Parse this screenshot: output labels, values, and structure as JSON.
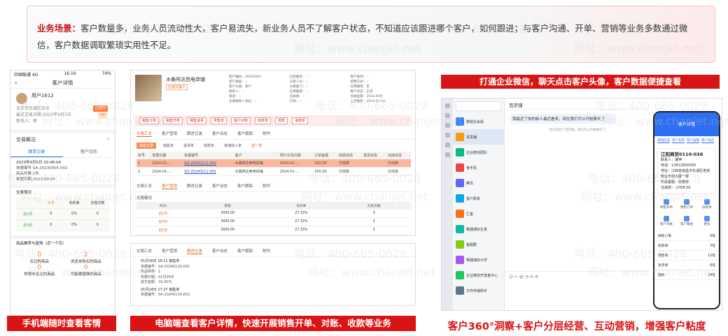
{
  "scenario": {
    "label": "业务场景：",
    "text": "客户数量多，业务人员流动性大，客户易流失，新业务人员不了解客户状态，不知道应该跟进哪个客户，如何跟进；与客户沟通、开单、营销等业务多数通过微信，客户数据调取繁琐实用性不足。"
  },
  "captions": {
    "phone": "手机端随时查看客情",
    "desktop": "电脑端查看客户详情，快速开展销售开单、对账、收款等业务",
    "wecom_title": "打通企业微信，聊天点击客户头像，客户数据便捷查看",
    "bottom_slogan": "客户360°洞察+客户分层经营、互动营销，增强客户粘度"
  },
  "watermarks": {
    "phone": "电话：400-665-0028",
    "site": "网址：www.chanjet.net"
  },
  "phone": {
    "status_left": "中国联通 4G",
    "status_time": "16:16",
    "status_right": "74%",
    "nav_title": "客户详情",
    "customer_name": "用户1612",
    "customer_sub": "北京市东城区东华",
    "customer_line2": "最近交易日期:2023年9月5日",
    "customer_line3": "联系人：郭",
    "tag": "已成交",
    "level": "VIP",
    "row_label": "交易概况",
    "tabs": [
      "跟单记录",
      "客户动态"
    ],
    "log_time": "2023年9月5日 10:46:04",
    "log_1": "单据编号:SA-20230905-002",
    "log_2": "商品件数:1件",
    "log_3": "单据日期:2023-09-05",
    "trade_title": "交易情况",
    "grid_head": [
      "",
      "本月",
      "毛利率",
      "交易次数"
    ],
    "grid_rows": [
      [
        "近1月",
        "0",
        "0%",
        "0"
      ],
      [
        "近3月",
        "0",
        "0%",
        "0"
      ]
    ],
    "goods_title": "商品推荐与复购（近一个月）",
    "big": [
      {
        "num": "0",
        "label": "买过的商品"
      },
      {
        "num": "2",
        "label": "浏览未购买的商品"
      },
      {
        "num": "0",
        "label": "热销未关注的商品"
      },
      {
        "num": "0",
        "label": "可能被替换的商品"
      }
    ]
  },
  "desktop": {
    "title": "木桑阿达西电焊铺",
    "sub": "已成交客户",
    "cols": [
      [
        "客户编码：00010001",
        "客户类型：--",
        "客户分类：客户",
        "联系人：--",
        "电话：--",
        "主要联系人地址：--"
      ],
      [
        "已签服务：--",
        "分管人员：--",
        "分管部门：--",
        "信用额度：--",
        "已收款：--",
        "欠款：--"
      ],
      [
        "客户级别：--",
        "结算方式：--",
        "信用期限：否",
        "客户状态：正常",
        "往来金额：2516.00元",
        "上次联系：2024-01-16"
      ]
    ],
    "toolbar": [
      "销售订单",
      "销售开单",
      "销售退货",
      "零售单",
      "客户对账",
      "收款单",
      "收款",
      "退款单"
    ],
    "tabs": [
      "交易汇总",
      "客户营销",
      "跟进记录",
      "客户动态",
      "客户跟踪",
      "附件"
    ],
    "subtabs": [
      "销售记录",
      "销售单",
      "退货单",
      "收款单",
      "其他收入单",
      "退一单"
    ],
    "table_head": [
      "序号",
      "单据日期",
      "单据编号",
      "客户",
      "预计交货日期",
      "订单金额",
      "收款状态",
      "发票状态",
      "出库状态"
    ],
    "table_rows": [
      [
        "1",
        "2024-01-...",
        "SO-20240111-002",
        "木桑阿达西电焊铺",
        "2024-01-...",
        "250.00",
        "已收款",
        "",
        "已出库"
      ],
      [
        "2",
        "2024-01-...",
        "SO-20240111-001",
        "木桑阿达西电焊铺",
        "2024-01-...",
        "250.00",
        "已收款",
        "",
        "已出库"
      ]
    ],
    "sec_title": "交易概况",
    "tbl2_head": [
      "时间",
      "销售",
      "毛利率",
      "交易次数"
    ],
    "tbl2_rows": [
      [
        "近1月",
        "3000.00",
        "27.33%",
        "3"
      ],
      [
        "近3月",
        "3000.00",
        "27.33%",
        "3"
      ],
      [
        "近1年",
        "3000.00",
        "27.33%",
        "3"
      ]
    ]
  },
  "desktop2": {
    "tabs": [
      "交易汇总",
      "客户营销",
      "跟进记录",
      "客户动态",
      "客户跟踪",
      "附件"
    ],
    "entries": [
      {
        "hd": "01月16日 16:11   销售单",
        "lines": [
          "单据编号：SA-20240116-001",
          "商品种类：1",
          "单据日期：01月16日",
          "成交金额：16.00元"
        ]
      },
      {
        "hd": "01月14日 17:27   销售单",
        "lines": [
          "单据编号：SA-20240114-002"
        ]
      }
    ]
  },
  "wecom": {
    "chats": [
      {
        "name": "群组社会组",
        "color": "#3b82f6"
      },
      {
        "name": "百货铺",
        "color": "#f59e0b"
      },
      {
        "name": "企业微信团队",
        "color": "#10b981"
      },
      {
        "name": "官手机",
        "color": "#ef4444"
      },
      {
        "name": "腾讯",
        "color": "#6366f1"
      },
      {
        "name": "客户联系",
        "color": "#0ea5e9"
      },
      {
        "name": "汇客",
        "color": "#f97316"
      },
      {
        "name": "畅捷通好生意",
        "color": "#14b8a6"
      },
      {
        "name": "客服群",
        "color": "#84cc16"
      },
      {
        "name": "畅捷通好大学",
        "color": "#a855f7"
      },
      {
        "name": "企业微信开发者中心",
        "color": "#22c55e"
      },
      {
        "name": "文件传输助手",
        "color": "#64748b"
      }
    ],
    "chat_title": "百货铺",
    "msg": "我最近了你的新人最近看来，现在我们可以开始聊天了",
    "sys": "你已添加了百货铺，现在可以开始聊天了",
    "input_icons": "☺ ✂ ▤ ◔ ✉ ⚙",
    "phone_title": "客户详情",
    "phone_tabs": [
      "基础信息",
      "客户标签",
      "客户画像",
      "客户动态"
    ],
    "card_name": "江阳商贸0110-036",
    "card_lines": [
      "联系人：潘神",
      "电话：13812800000",
      "地址：江西省南昌市东湖区老城鞋业市场大厦一楼",
      "所属客服：张雅菲",
      "往来款：-2768.56"
    ],
    "icons": [
      "销售开单",
      "销售订单",
      "收款单",
      "客户对账",
      "客户跟进",
      "更多"
    ],
    "rows": [
      [
        "销售订单",
        "6笔"
      ],
      [
        "收款单",
        "3笔"
      ],
      [
        "销售单",
        "12笔"
      ],
      [
        "退货单",
        "6笔"
      ],
      [
        "图标",
        "24笔"
      ]
    ]
  }
}
